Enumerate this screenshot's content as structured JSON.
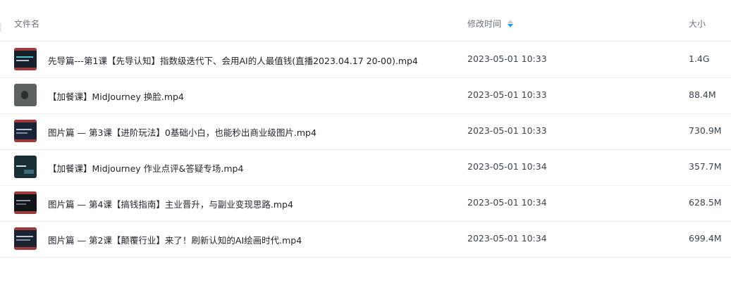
{
  "header": {
    "name_label": "文件名",
    "time_label": "修改时间",
    "size_label": "大小"
  },
  "colors": {
    "sort_active": "#1e9bf0",
    "sort_inactive": "#c9cdd4",
    "divider": "#f0f1f3"
  },
  "files": [
    {
      "name": "先导篇---第1课【先导认知】指数级迭代下、会用AI的人最值钱(直播2023.04.17 20-00).mp4",
      "time": "2023-05-01 10:33",
      "size": "1.4G",
      "thumb_icon": "video-thumbnail-icon"
    },
    {
      "name": "【加餐课】MidJourney 换脸.mp4",
      "time": "2023-05-01 10:33",
      "size": "88.4M",
      "thumb_icon": "video-thumbnail-icon"
    },
    {
      "name": "图片篇 — 第3课【进阶玩法】0基础小白，也能秒出商业级图片.mp4",
      "time": "2023-05-01 10:33",
      "size": "730.9M",
      "thumb_icon": "video-thumbnail-icon"
    },
    {
      "name": "【加餐课】Midjourney 作业点评&答疑专场.mp4",
      "time": "2023-05-01 10:34",
      "size": "357.7M",
      "thumb_icon": "video-thumbnail-icon"
    },
    {
      "name": "图片篇 — 第4课【搞钱指南】主业晋升，与副业变现思路.mp4",
      "time": "2023-05-01 10:34",
      "size": "628.5M",
      "thumb_icon": "video-thumbnail-icon"
    },
    {
      "name": "图片篇 — 第2课【颠覆行业】来了！刷新认知的AI绘画时代.mp4",
      "time": "2023-05-01 10:34",
      "size": "699.4M",
      "thumb_icon": "video-thumbnail-icon"
    }
  ]
}
